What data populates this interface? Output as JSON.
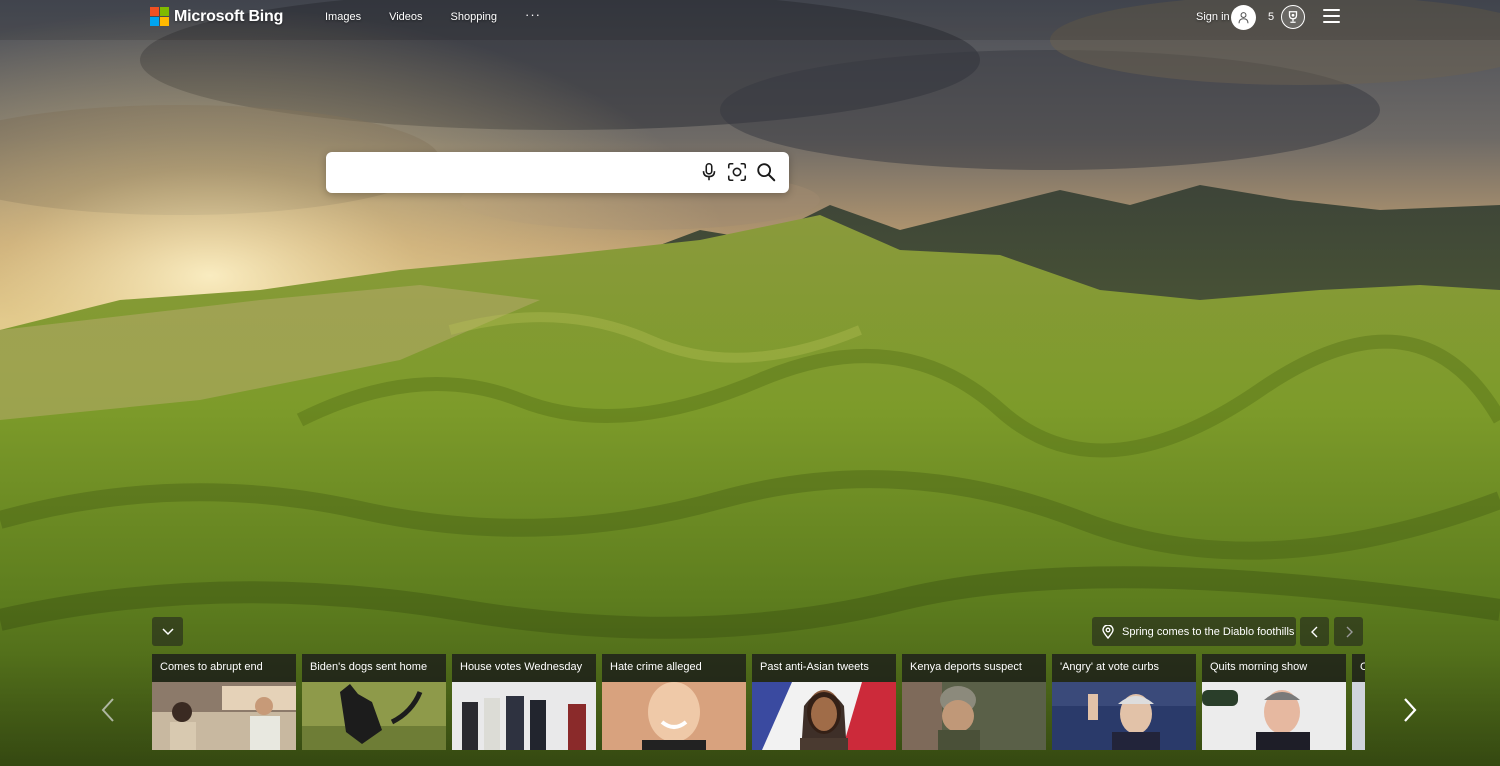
{
  "brand": {
    "name": "Microsoft Bing"
  },
  "nav": {
    "items": [
      "Images",
      "Videos",
      "Shopping"
    ],
    "more": "···"
  },
  "account": {
    "signin_label": "Sign in",
    "reward_points": "5"
  },
  "search": {
    "value": "",
    "placeholder": ""
  },
  "image_caption": {
    "text": "Spring comes to the Diablo foothills"
  },
  "news": {
    "items": [
      {
        "title": "Comes to abrupt end"
      },
      {
        "title": "Biden's dogs sent home"
      },
      {
        "title": "House votes Wednesday"
      },
      {
        "title": "Hate crime alleged"
      },
      {
        "title": "Past anti-Asian tweets"
      },
      {
        "title": "Kenya deports suspect"
      },
      {
        "title": "'Angry' at vote curbs"
      },
      {
        "title": "Quits morning show"
      },
      {
        "title": "C"
      }
    ]
  },
  "colors": {
    "logo_red": "#f25022",
    "logo_green": "#7fba00",
    "logo_blue": "#00a4ef",
    "logo_yellow": "#ffb900",
    "search_icon": "#1a1a1a"
  }
}
